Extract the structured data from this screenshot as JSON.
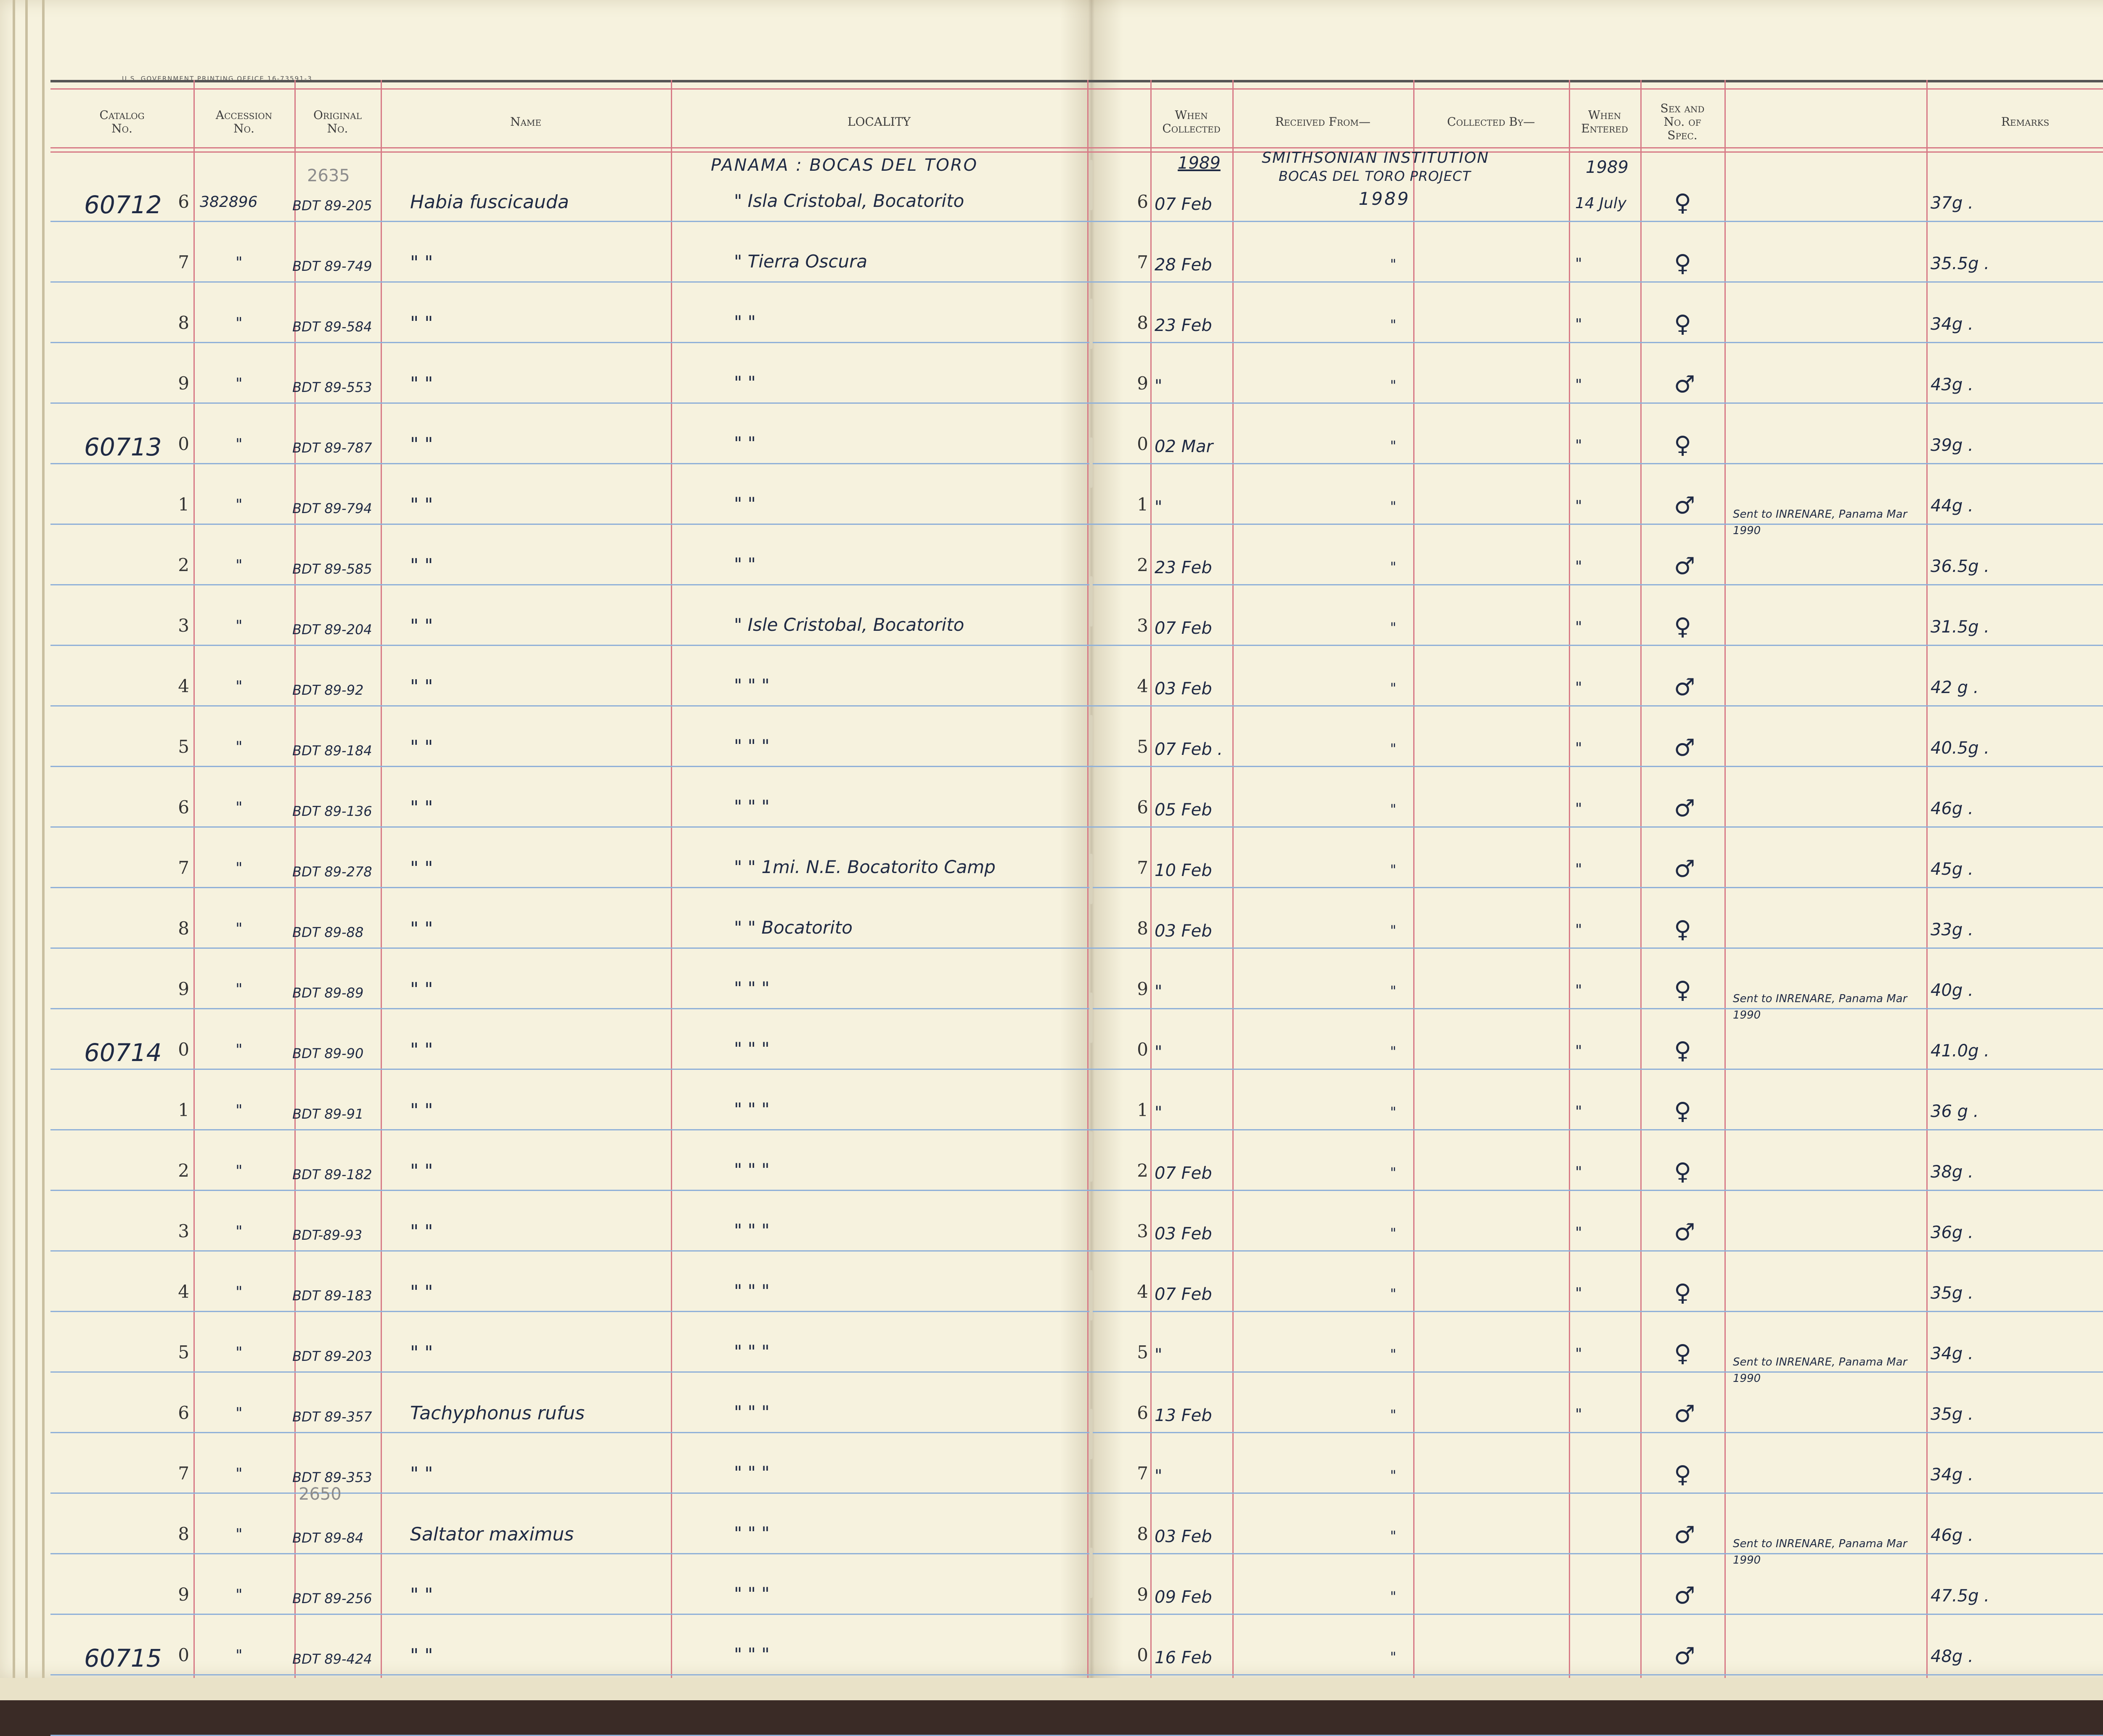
{
  "printer_line": "U.S. GOVERNMENT PRINTING OFFICE   16-73591-3",
  "columns": [
    {
      "key": "catalog",
      "label": "Catalog\nNo."
    },
    {
      "key": "accession",
      "label": "Accession\nNo."
    },
    {
      "key": "original",
      "label": "Original\nNo."
    },
    {
      "key": "name",
      "label": "Name"
    },
    {
      "key": "locality",
      "label": "LOCALITY"
    },
    {
      "key": "collected",
      "label": "When\nCollected"
    },
    {
      "key": "received",
      "label": "Received From—"
    },
    {
      "key": "collected_by",
      "label": "Collected By—"
    },
    {
      "key": "entered",
      "label": "When\nEntered"
    },
    {
      "key": "sex",
      "label": "Sex and\nNo. of\nSpec."
    },
    {
      "key": "notes",
      "label": ""
    },
    {
      "key": "remarks",
      "label": "Remarks"
    }
  ],
  "header_notes": {
    "original_pencil_top": "2635",
    "locality_title": "PANAMA : BOCAS DEL TORO",
    "collected_year": "1989",
    "received_line1": "SMITHSONIAN INSTITUTION",
    "received_line2": "BOCAS DEL TORO PROJECT",
    "received_year": "1989",
    "entered_year": "1989",
    "original_pencil_mid": "2650"
  },
  "left_numbers": [
    "6",
    "7",
    "8",
    "9",
    "0",
    "1",
    "2",
    "3",
    "4",
    "5",
    "6",
    "7",
    "8",
    "9",
    "0",
    "1",
    "2",
    "3",
    "4",
    "5",
    "6",
    "7",
    "8",
    "9",
    "0"
  ],
  "right_numbers": [
    "6",
    "7",
    "8",
    "9",
    "0",
    "1",
    "2",
    "3",
    "4",
    "5",
    "6",
    "7",
    "8",
    "9",
    "0",
    "1",
    "2",
    "3",
    "4",
    "5",
    "6",
    "7",
    "8",
    "9",
    "0"
  ],
  "catalog_prefixes": [
    {
      "row": 0,
      "text": "60712"
    },
    {
      "row": 4,
      "text": "60713"
    },
    {
      "row": 14,
      "text": "60714"
    },
    {
      "row": 24,
      "text": "60715"
    }
  ],
  "rows": [
    {
      "accession": "382896",
      "original": "BDT 89-205",
      "name": "Habia fuscicauda",
      "locality": "\"   Isla Cristobal, Bocatorito",
      "collected": "07 Feb",
      "received": "",
      "entered": "14 July",
      "sex": "♀",
      "note": "",
      "remarks": "37g ."
    },
    {
      "accession": "\"",
      "original": "BDT 89-749",
      "name": "\"      \"",
      "locality": "\"        Tierra Oscura",
      "collected": "28 Feb",
      "received": "\"",
      "entered": "\"",
      "sex": "♀",
      "note": "",
      "remarks": "35.5g ."
    },
    {
      "accession": "\"",
      "original": "BDT 89-584",
      "name": "\"      \"",
      "locality": "\"           \"",
      "collected": "23 Feb",
      "received": "\"",
      "entered": "\"",
      "sex": "♀",
      "note": "",
      "remarks": "34g ."
    },
    {
      "accession": "\"",
      "original": "BDT 89-553",
      "name": "\"      \"",
      "locality": "\"           \"",
      "collected": "\"",
      "received": "\"",
      "entered": "\"",
      "sex": "♂",
      "note": "",
      "remarks": "43g ."
    },
    {
      "accession": "\"",
      "original": "BDT 89-787",
      "name": "\"      \"",
      "locality": "\"           \"",
      "collected": "02 Mar",
      "received": "\"",
      "entered": "\"",
      "sex": "♀",
      "note": "",
      "remarks": "39g ."
    },
    {
      "accession": "\"",
      "original": "BDT 89-794",
      "name": "\"      \"",
      "locality": "\"           \"",
      "collected": "\"",
      "received": "\"",
      "entered": "\"",
      "sex": "♂",
      "note": "",
      "remarks": "44g ."
    },
    {
      "accession": "\"",
      "original": "BDT 89-585",
      "name": "\"      \"",
      "locality": "\"           \"",
      "collected": "23 Feb",
      "received": "\"",
      "entered": "\"",
      "sex": "♂",
      "note": "Sent to INRENARE, Panama    Mar 1990",
      "remarks": "36.5g ."
    },
    {
      "accession": "\"",
      "original": "BDT 89-204",
      "name": "\"      \"",
      "locality": "\"   Isle Cristobal, Bocatorito",
      "collected": "07 Feb",
      "received": "\"",
      "entered": "\"",
      "sex": "♀",
      "note": "",
      "remarks": "31.5g ."
    },
    {
      "accession": "\"",
      "original": "BDT 89-92",
      "name": "\"      \"",
      "locality": "\"       \"       \"",
      "collected": "03 Feb",
      "received": "\"",
      "entered": "\"",
      "sex": "♂",
      "note": "",
      "remarks": "42 g ."
    },
    {
      "accession": "\"",
      "original": "BDT 89-184",
      "name": "\"      \"",
      "locality": "\"       \"       \"",
      "collected": "07 Feb .",
      "received": "\"",
      "entered": "\"",
      "sex": "♂",
      "note": "",
      "remarks": "40.5g ."
    },
    {
      "accession": "\"",
      "original": "BDT 89-136",
      "name": "\"      \"",
      "locality": "\"       \"       \"",
      "collected": "05 Feb",
      "received": "\"",
      "entered": "\"",
      "sex": "♂",
      "note": "",
      "remarks": "46g ."
    },
    {
      "accession": "\"",
      "original": "BDT 89-278",
      "name": "\"      \"",
      "locality": "\"    \"   1mi. N.E. Bocatorito Camp",
      "collected": "10 Feb",
      "received": "\"",
      "entered": "\"",
      "sex": "♂",
      "note": "",
      "remarks": "45g ."
    },
    {
      "accession": "\"",
      "original": "BDT 89-88",
      "name": "\"      \"",
      "locality": "\"    \"    Bocatorito",
      "collected": "03 Feb",
      "received": "\"",
      "entered": "\"",
      "sex": "♀",
      "note": "",
      "remarks": "33g ."
    },
    {
      "accession": "\"",
      "original": "BDT 89-89",
      "name": "\"      \"",
      "locality": "\"       \"       \"",
      "collected": "\"",
      "received": "\"",
      "entered": "\"",
      "sex": "♀",
      "note": "",
      "remarks": "40g ."
    },
    {
      "accession": "\"",
      "original": "BDT 89-90",
      "name": "\"      \"",
      "locality": "\"       \"       \"",
      "collected": "\"",
      "received": "\"",
      "entered": "\"",
      "sex": "♀",
      "note": "Sent to INRENARE, Panama    Mar 1990",
      "remarks": "41.0g ."
    },
    {
      "accession": "\"",
      "original": "BDT 89-91",
      "name": "\"      \"",
      "locality": "\"       \"       \"",
      "collected": "\"",
      "received": "\"",
      "entered": "\"",
      "sex": "♀",
      "note": "",
      "remarks": "36 g ."
    },
    {
      "accession": "\"",
      "original": "BDT 89-182",
      "name": "\"      \"",
      "locality": "\"       \"       \"",
      "collected": "07 Feb",
      "received": "\"",
      "entered": "\"",
      "sex": "♀",
      "note": "",
      "remarks": "38g ."
    },
    {
      "accession": "\"",
      "original": "BDT-89-93",
      "name": "\"      \"",
      "locality": "\"       \"       \"",
      "collected": "03 Feb",
      "received": "\"",
      "entered": "\"",
      "sex": "♂",
      "note": "",
      "remarks": "36g ."
    },
    {
      "accession": "\"",
      "original": "BDT 89-183",
      "name": "\"      \"",
      "locality": "\"       \"       \"",
      "collected": "07 Feb",
      "received": "\"",
      "entered": "\"",
      "sex": "♀",
      "note": "",
      "remarks": "35g ."
    },
    {
      "accession": "\"",
      "original": "BDT 89-203",
      "name": "\"      \"",
      "locality": "\"       \"       \"",
      "collected": "\"",
      "received": "\"",
      "entered": "\"",
      "sex": "♀",
      "note": "",
      "remarks": "34g ."
    },
    {
      "accession": "\"",
      "original": "BDT 89-357",
      "name": "Tachyphonus rufus",
      "locality": "\"       \"       \"",
      "collected": "13 Feb",
      "received": "\"",
      "entered": "\"",
      "sex": "♂",
      "note": "Sent to INRENARE, Panama    Mar 1990",
      "remarks": "35g ."
    },
    {
      "accession": "\"",
      "original": "BDT 89-353",
      "name": "\"      \"",
      "locality": "\"       \"       \"",
      "collected": "\"",
      "received": "\"",
      "entered": "",
      "sex": "♀",
      "note": "",
      "remarks": "34g ."
    },
    {
      "accession": "\"",
      "original": "BDT 89-84",
      "name": "Saltator maximus",
      "locality": "\"       \"       \"",
      "collected": "03 Feb",
      "received": "\"",
      "entered": "",
      "sex": "♂",
      "note": "",
      "remarks": "46g ."
    },
    {
      "accession": "\"",
      "original": "BDT 89-256",
      "name": "\"      \"",
      "locality": "\"       \"       \"",
      "collected": "09 Feb",
      "received": "\"",
      "entered": "",
      "sex": "♂",
      "note": "Sent to INRENARE, Panama    Mar 1990",
      "remarks": "47.5g ."
    },
    {
      "accession": "\"",
      "original": "BDT 89-424",
      "name": "\"      \"",
      "locality": "\"       \"       \"",
      "collected": "16 Feb",
      "received": "\"",
      "entered": "",
      "sex": "♂",
      "note": "",
      "remarks": "48g ."
    }
  ]
}
